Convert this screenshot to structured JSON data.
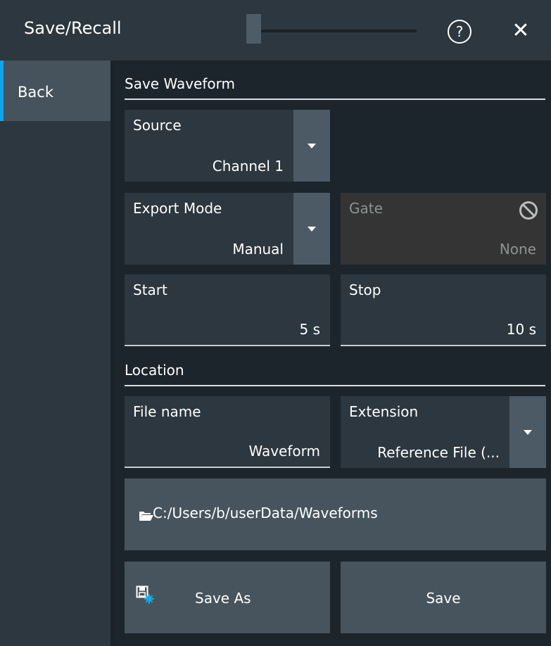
{
  "window": {
    "title": "Save/Recall",
    "help_glyph": "?",
    "close_glyph": "✕",
    "icons": [
      "help-icon",
      "close-icon",
      "no-entry-icon",
      "folder-open-icon",
      "save-disk-icon",
      "chevron-down-icon"
    ]
  },
  "sidebar": {
    "back_label": "Back"
  },
  "save_waveform": {
    "section_title": "Save Waveform",
    "source": {
      "label": "Source",
      "value": "Channel 1"
    },
    "export_mode": {
      "label": "Export Mode",
      "value": "Manual"
    },
    "gate": {
      "label": "Gate",
      "value": "None"
    },
    "start": {
      "label": "Start",
      "value": "5 s"
    },
    "stop": {
      "label": "Stop",
      "value": "10 s"
    }
  },
  "location": {
    "section_title": "Location",
    "file_name": {
      "label": "File name",
      "value": "Waveform"
    },
    "extension": {
      "label": "Extension",
      "value": "Reference File (..."
    },
    "path": "C:/Users/b/userData/Waveforms"
  },
  "actions": {
    "save_as_label": "Save As",
    "save_label": "Save"
  },
  "colors": {
    "background": "#1c252c",
    "panel": "#2c373f",
    "button": "#47545e",
    "accent": "#0fa4f0",
    "disabled_panel": "#343434"
  }
}
